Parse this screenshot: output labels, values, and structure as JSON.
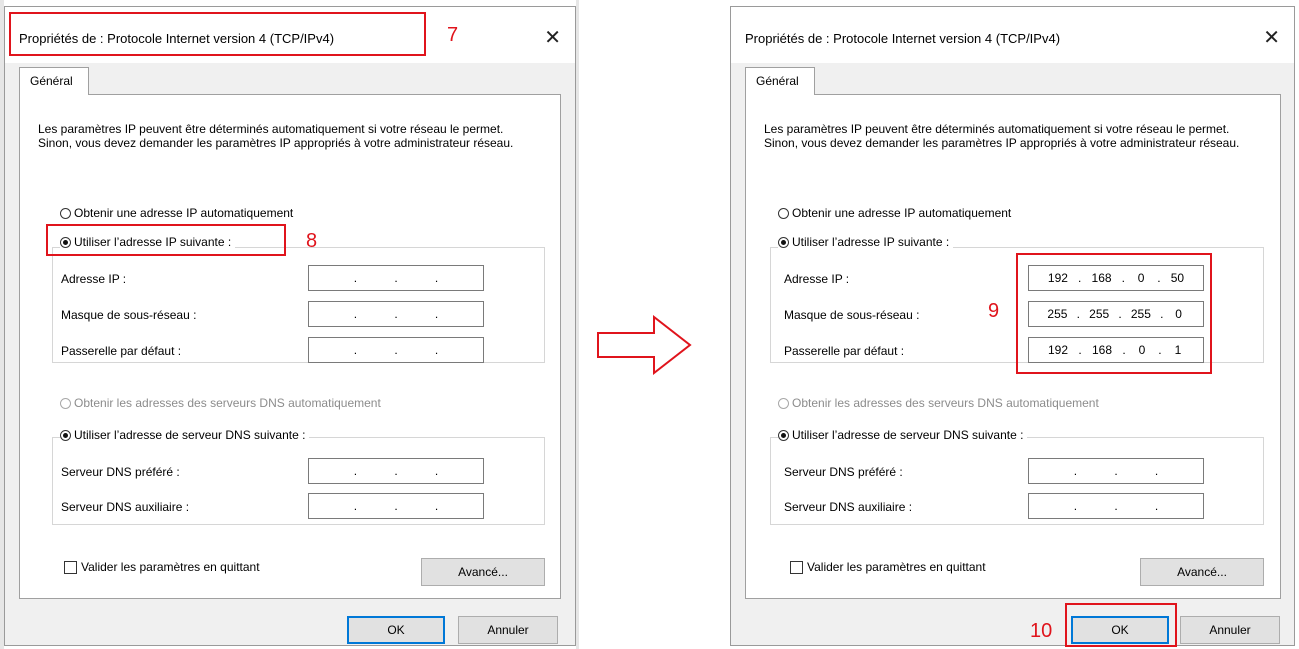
{
  "annotations": {
    "step7": "7",
    "step8": "8",
    "step9": "9",
    "step10": "10",
    "annotation_color": "#e0141c"
  },
  "dialog_left": {
    "title": "Propriétés de : Protocole Internet version 4 (TCP/IPv4)",
    "tab": "Général",
    "description": "Les paramètres IP peuvent être déterminés automatiquement si votre réseau le permet. Sinon, vous devez demander les paramètres IP appropriés à votre administrateur réseau.",
    "radio_ip_auto": "Obtenir une adresse IP automatiquement",
    "radio_ip_manual": "Utiliser l’adresse IP suivante :",
    "label_ip": "Adresse IP :",
    "label_mask": "Masque de sous-réseau :",
    "label_gateway": "Passerelle par défaut :",
    "ip": [
      "",
      "",
      "",
      ""
    ],
    "mask": [
      "",
      "",
      "",
      ""
    ],
    "gateway": [
      "",
      "",
      "",
      ""
    ],
    "radio_dns_auto": "Obtenir les adresses des serveurs DNS automatiquement",
    "radio_dns_manual": "Utiliser l’adresse de serveur DNS suivante :",
    "label_dns_pref": "Serveur DNS préféré :",
    "label_dns_aux": "Serveur DNS auxiliaire :",
    "dns_pref": [
      "",
      "",
      "",
      ""
    ],
    "dns_aux": [
      "",
      "",
      "",
      ""
    ],
    "check_validate": "Valider les paramètres en quittant",
    "advanced_button": "Avancé...",
    "ok_button": "OK",
    "cancel_button": "Annuler"
  },
  "dialog_right": {
    "title": "Propriétés de : Protocole Internet version 4 (TCP/IPv4)",
    "tab": "Général",
    "description": "Les paramètres IP peuvent être déterminés automatiquement si votre réseau le permet. Sinon, vous devez demander les paramètres IP appropriés à votre administrateur réseau.",
    "radio_ip_auto": "Obtenir une adresse IP automatiquement",
    "radio_ip_manual": "Utiliser l’adresse IP suivante :",
    "label_ip": "Adresse IP :",
    "label_mask": "Masque de sous-réseau :",
    "label_gateway": "Passerelle par défaut :",
    "ip": [
      "192",
      "168",
      "0",
      "50"
    ],
    "mask": [
      "255",
      "255",
      "255",
      "0"
    ],
    "gateway": [
      "192",
      "168",
      "0",
      "1"
    ],
    "radio_dns_auto": "Obtenir les adresses des serveurs DNS automatiquement",
    "radio_dns_manual": "Utiliser l’adresse de serveur DNS suivante :",
    "label_dns_pref": "Serveur DNS préféré :",
    "label_dns_aux": "Serveur DNS auxiliaire :",
    "dns_pref": [
      "",
      "",
      "",
      ""
    ],
    "dns_aux": [
      "",
      "",
      "",
      ""
    ],
    "check_validate": "Valider les paramètres en quittant",
    "advanced_button": "Avancé...",
    "ok_button": "OK",
    "cancel_button": "Annuler"
  },
  "icons": {
    "close": "close-icon",
    "arrow": "right-arrow-icon"
  }
}
